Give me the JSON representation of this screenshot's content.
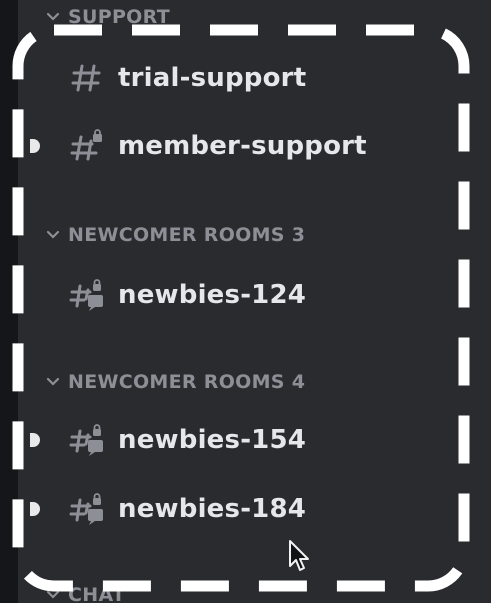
{
  "sidebar": {
    "categories": [
      {
        "label": "SUPPORT",
        "channels": [
          {
            "name": "trial-support",
            "icon": "hash-icon"
          },
          {
            "name": "member-support",
            "icon": "locked-hash-icon"
          }
        ]
      },
      {
        "label": "NEWCOMER ROOMS 3",
        "channels": [
          {
            "name": "newbies-124",
            "icon": "locked-thread-icon"
          }
        ]
      },
      {
        "label": "NEWCOMER ROOMS 4",
        "channels": [
          {
            "name": "newbies-154",
            "icon": "locked-thread-icon"
          },
          {
            "name": "newbies-184",
            "icon": "locked-thread-icon"
          }
        ]
      },
      {
        "label": "CHAT",
        "channels": []
      }
    ]
  },
  "colors": {
    "background": "#2a2b2f",
    "category_text": "#8d8f96",
    "channel_text": "#e6e7ea",
    "highlight_frame": "#ffffff"
  }
}
